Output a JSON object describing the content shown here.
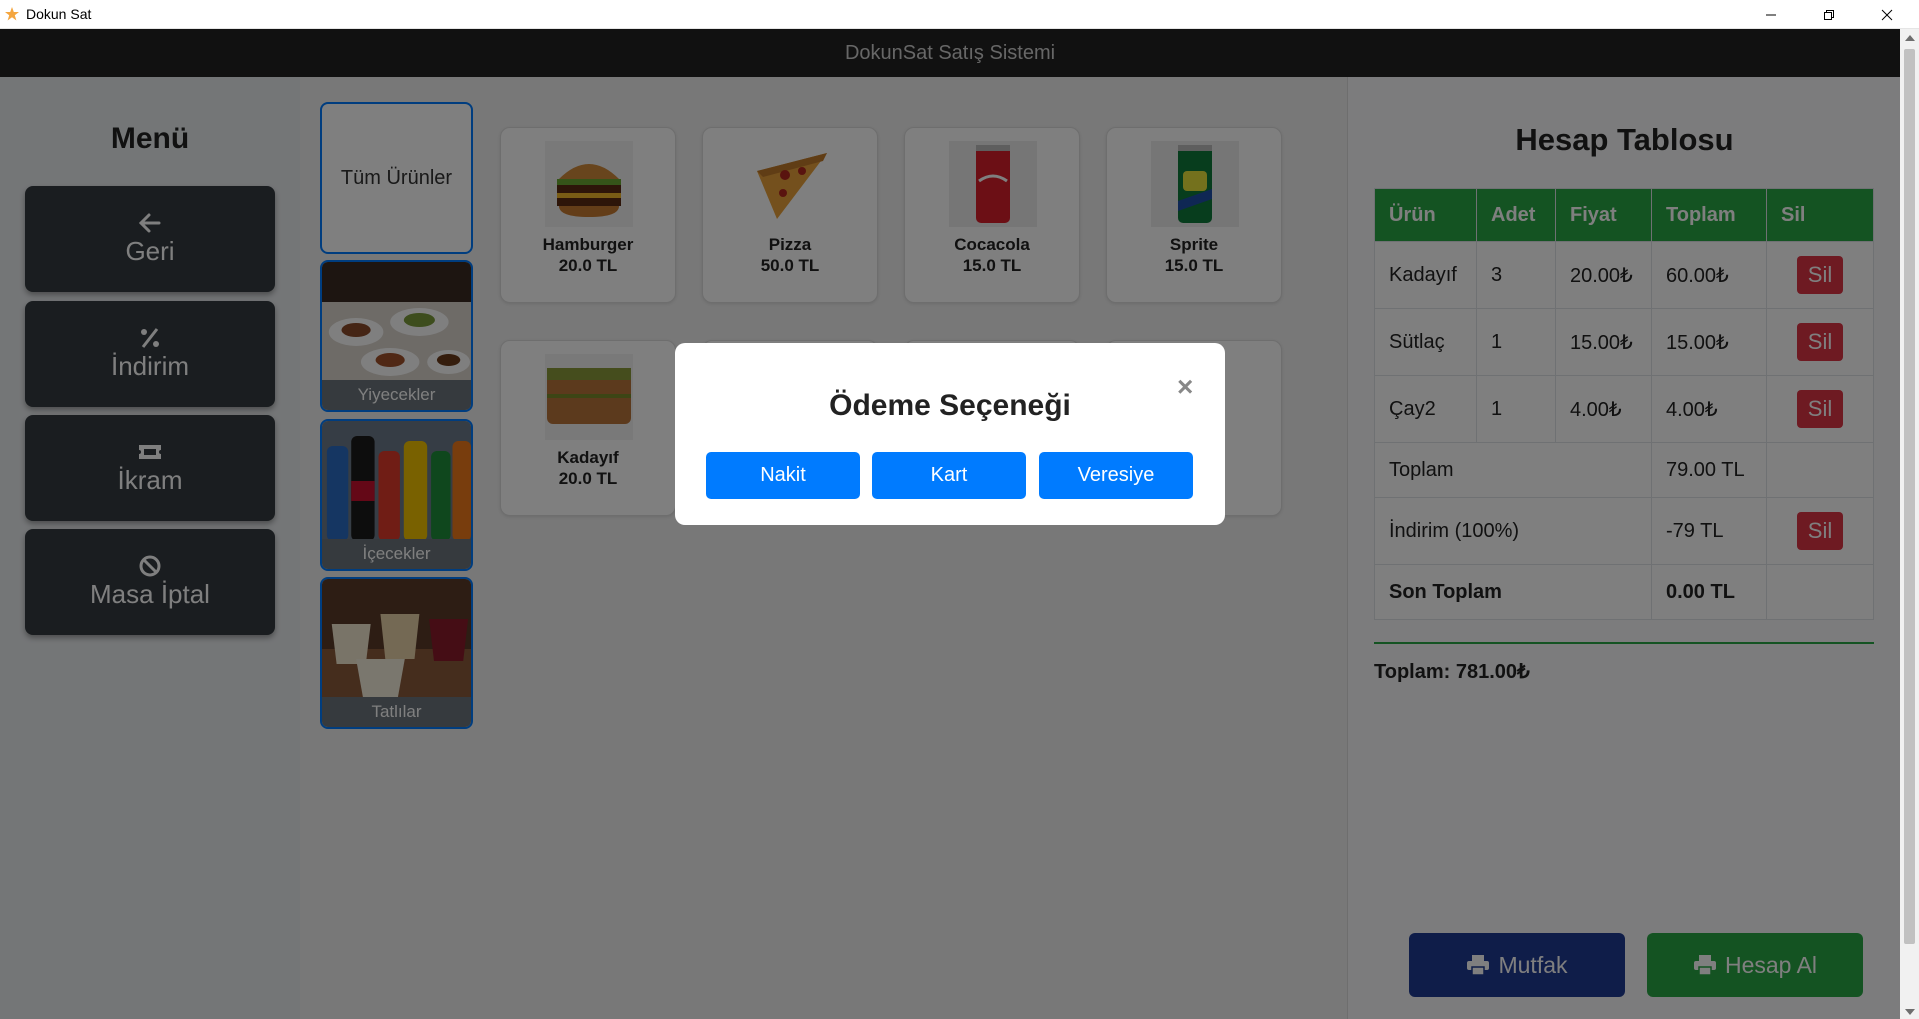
{
  "window": {
    "title": "Dokun Sat"
  },
  "header": {
    "title": "DokunSat Satış Sistemi"
  },
  "sidebar": {
    "title": "Menü",
    "buttons": [
      {
        "label": "Geri",
        "icon": "arrow-left-icon"
      },
      {
        "label": "İndirim",
        "icon": "percent-icon"
      },
      {
        "label": "İkram",
        "icon": "ticket-icon"
      },
      {
        "label": "Masa İptal",
        "icon": "ban-icon"
      }
    ]
  },
  "categories": [
    {
      "label": "Tüm Ürünler"
    },
    {
      "label": "Yiyecekler"
    },
    {
      "label": "İçecekler"
    },
    {
      "label": "Tatlılar"
    }
  ],
  "products": [
    {
      "name": "Hamburger",
      "price": "20.0 TL"
    },
    {
      "name": "Pizza",
      "price": "50.0 TL"
    },
    {
      "name": "Cocacola",
      "price": "15.0 TL"
    },
    {
      "name": "Sprite",
      "price": "15.0 TL"
    },
    {
      "name": "Kadayıf",
      "price": "20.0 TL"
    }
  ],
  "bill": {
    "title": "Hesap Tablosu",
    "columns": [
      "Ürün",
      "Adet",
      "Fiyat",
      "Toplam",
      "Sil"
    ],
    "rows": [
      {
        "product": "Kadayıf",
        "qty": "3",
        "price": "20.00₺",
        "total": "60.00₺",
        "action": "Sil"
      },
      {
        "product": "Sütlaç",
        "qty": "1",
        "price": "15.00₺",
        "total": "15.00₺",
        "action": "Sil"
      },
      {
        "product": "Çay2",
        "qty": "1",
        "price": "4.00₺",
        "total": "4.00₺",
        "action": "Sil"
      }
    ],
    "subtotal_label": "Toplam",
    "subtotal_value": "79.00 TL",
    "discount_label": "İndirim (100%)",
    "discount_value": "-79 TL",
    "discount_action": "Sil",
    "final_label": "Son Toplam",
    "final_value": "0.00 TL",
    "grand_total": "Toplam: 781.00₺",
    "kitchen_button": "Mutfak",
    "checkout_button": "Hesap Al"
  },
  "modal": {
    "title": "Ödeme Seçeneği",
    "close": "×",
    "options": [
      "Nakit",
      "Kart",
      "Veresiye"
    ]
  },
  "colors": {
    "header": "#222222",
    "primary": "#007bff",
    "success": "#28a745",
    "danger": "#dc3545",
    "sidebar_button": "#343a40",
    "kitchen_button": "#1f3a93"
  }
}
